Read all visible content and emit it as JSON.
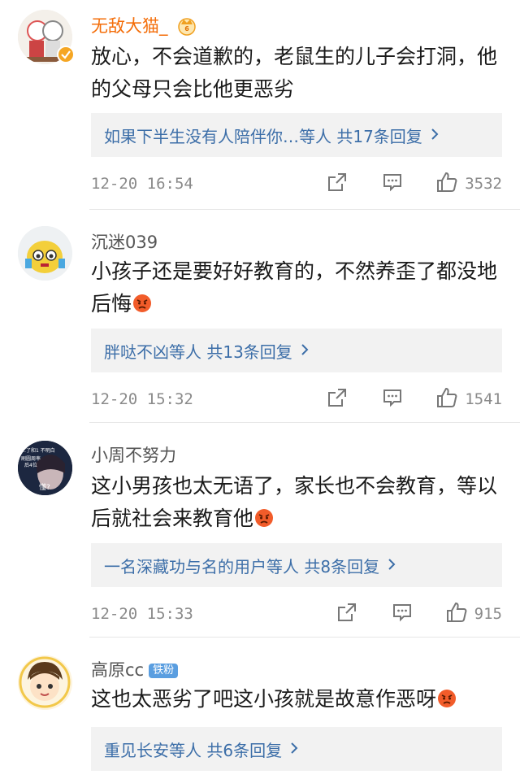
{
  "comments": [
    {
      "username": "无敌大猫_",
      "text": "放心，不会道歉的，老鼠生的儿子会打洞，他的父母只会比他更恶劣",
      "replies": "如果下半生没有人陪伴你…等人  共17条回复",
      "time": "12-20 16:54",
      "likes": "3532"
    },
    {
      "username": "沉迷039",
      "text": "小孩子还是要好好教育的，不然养歪了都没地后悔",
      "replies": "胖哒不凶等人  共13条回复",
      "time": "12-20 15:32",
      "likes": "1541"
    },
    {
      "username": "小周不努力",
      "avatar_text": [
        "…了和1 不明白",
        "刷圆周率",
        "后4位",
        "懂?"
      ],
      "text": "这小男孩也太无语了，家长也不会教育，等以后就社会来教育他",
      "replies": "一名深藏功与名的用户等人  共8条回复",
      "time": "12-20 15:33",
      "likes": "915"
    },
    {
      "username": "高原cc",
      "badge": "铁粉",
      "text": "这也太恶劣了吧这小孩就是故意作恶呀",
      "replies": "重见长安等人  共6条回复"
    }
  ],
  "icons": {
    "crown": "crown-icon",
    "verified": "verified-icon",
    "share": "share-icon",
    "comment": "comment-icon",
    "like": "like-icon",
    "emoji": "angry-face-icon",
    "chevron": "chevron-right-icon"
  },
  "colors": {
    "vip_name": "#f46e0a",
    "reply_link": "#3c6ea8",
    "reply_bg": "#f2f2f2",
    "meta": "#8a8a8a",
    "badge": "#5a9ee0"
  }
}
